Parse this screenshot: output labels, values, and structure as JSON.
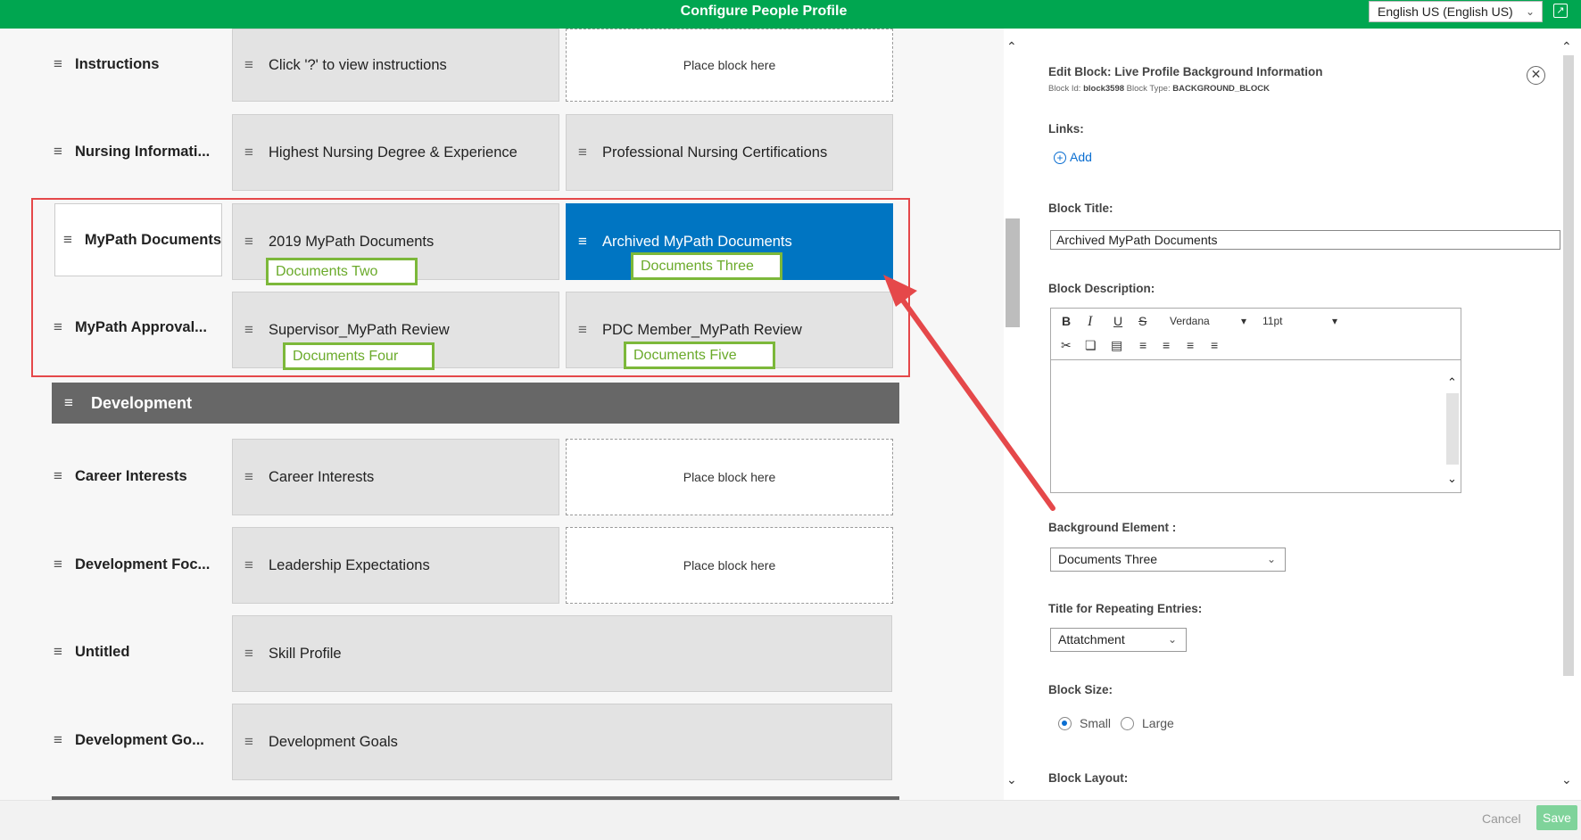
{
  "header": {
    "title": "Configure People Profile",
    "language": "English US (English US)"
  },
  "rows": [
    {
      "label": "Instructions",
      "blocks": [
        "Click '?' to view instructions"
      ],
      "placeholder": "Place block here"
    },
    {
      "label": "Nursing Informati...",
      "blocks": [
        "Highest Nursing Degree & Experience",
        "Professional Nursing Certifications"
      ]
    },
    {
      "label": "MyPath Documents",
      "blocks": [
        "2019 MyPath Documents",
        "Archived MyPath Documents"
      ]
    },
    {
      "label": "MyPath Approval...",
      "blocks": [
        "Supervisor_MyPath Review",
        "PDC Member_MyPath Review"
      ]
    },
    {
      "label": "Career Interests",
      "blocks": [
        "Career Interests"
      ],
      "placeholder": "Place block here"
    },
    {
      "label": "Development Foc...",
      "blocks": [
        "Leadership Expectations"
      ],
      "placeholder": "Place block here"
    },
    {
      "label": "Untitled",
      "blocks": [
        "Skill Profile"
      ]
    },
    {
      "label": "Development Go...",
      "blocks": [
        "Development Goals"
      ]
    }
  ],
  "section": {
    "title": "Development"
  },
  "annotations": [
    "Documents Two",
    "Documents Three",
    "Documents Four",
    "Documents Five"
  ],
  "panel": {
    "edit_title": "Edit Block:  Live Profile Background Information",
    "block_id_label": "Block Id:",
    "block_id": "block3598",
    "block_type_label": "Block Type:",
    "block_type": "BACKGROUND_BLOCK",
    "links_label": "Links:",
    "add_label": "Add",
    "block_title_label": "Block Title:",
    "block_title_value": "Archived MyPath Documents",
    "block_description_label": "Block Description:",
    "font": "Verdana",
    "font_size": "11pt",
    "background_element_label": "Background Element :",
    "background_element_value": "Documents Three",
    "repeating_title_label": "Title for Repeating Entries:",
    "repeating_title_value": "Attatchment",
    "block_size_label": "Block Size:",
    "size_small": "Small",
    "size_large": "Large",
    "size_selected": "Small",
    "block_layout_label": "Block Layout:"
  },
  "footer": {
    "cancel": "Cancel",
    "save": "Save"
  },
  "colors": {
    "header": "#00a650",
    "selected_block": "#0075c2",
    "annotation": "#7cb83a",
    "highlight": "#e5484a",
    "section": "#676767"
  }
}
